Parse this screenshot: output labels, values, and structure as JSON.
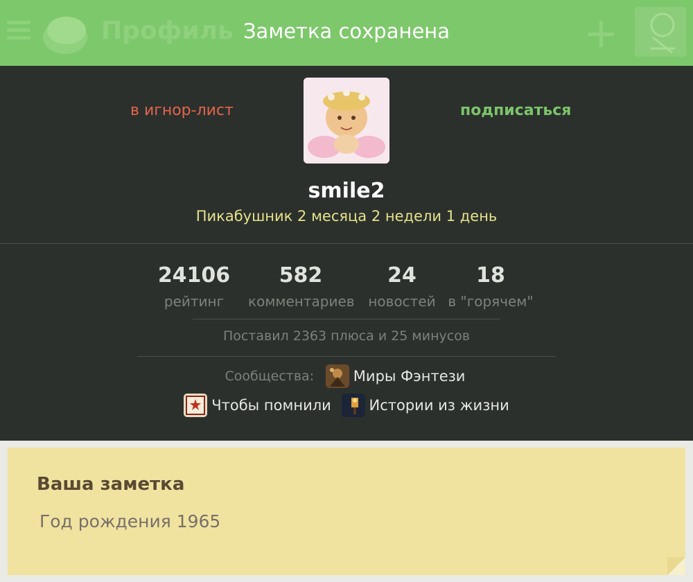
{
  "topbar": {
    "title": "Профиль",
    "toast": "Заметка сохранена",
    "menu_icon": "hamburger-menu-icon",
    "logo_icon": "pikabu-logo-icon",
    "add_icon": "plus-icon",
    "avatar_icon": "user-avatar-icon"
  },
  "profile": {
    "ignore_label": "в игнор-лист",
    "subscribe_label": "подписаться",
    "username": "smile2",
    "age_text": "Пикабушник 2 месяца 2 недели 1 день"
  },
  "stats": [
    {
      "value": "24106",
      "label": "рейтинг"
    },
    {
      "value": "582",
      "label": "комментариев"
    },
    {
      "value": "24",
      "label": "новостей"
    },
    {
      "value": "18",
      "label": "в \"горячем\""
    }
  ],
  "votes_text": "Поставил 2363 плюса и 25 минусов",
  "communities": {
    "label": "Сообщества:",
    "items": [
      {
        "name": "Миры Фэнтези",
        "icon": "fantasy-worlds-icon"
      },
      {
        "name": "Чтобы помнили",
        "icon": "remember-icon"
      },
      {
        "name": "Истории из жизни",
        "icon": "life-stories-icon"
      }
    ]
  },
  "note": {
    "title": "Ваша заметка",
    "text": "Год рождения 1965"
  },
  "colors": {
    "topbar_bg": "#7ec86c",
    "profile_bg": "#2c302d",
    "ignore": "#e2654a",
    "subscribe": "#7bc46a",
    "age_text": "#e4e28a",
    "note_bg": "#f0e3a0"
  }
}
